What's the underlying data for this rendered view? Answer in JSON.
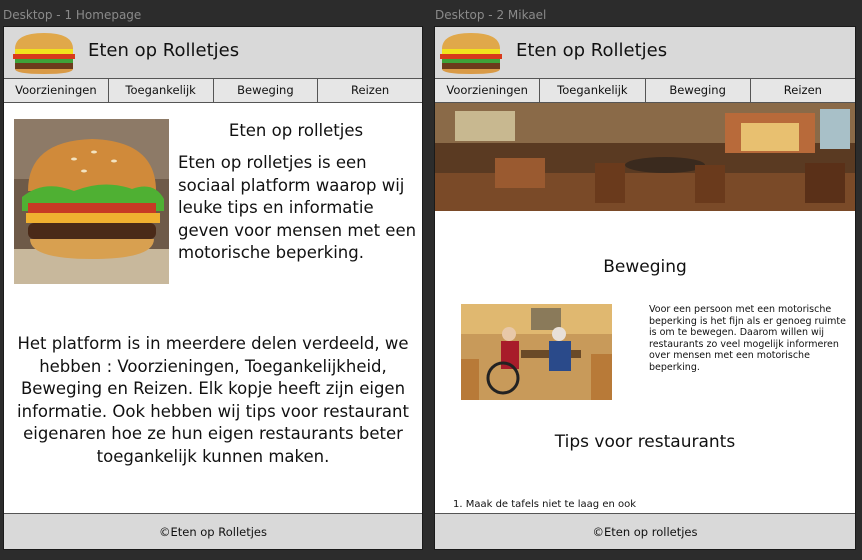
{
  "frames": [
    {
      "label": "Desktop - 1 Homepage",
      "brand": "Eten op Rolletjes",
      "nav": [
        "Voorzieningen",
        "Toegankelijk",
        "Beweging",
        "Reizen"
      ],
      "title": "Eten op rolletjes",
      "lead": "Eten op rolletjes is een sociaal platform waarop wij leuke tips en informatie geven voor mensen met een motorische beperking.",
      "body": "Het platform is in meerdere delen verdeeld, we hebben : Voorzieningen, Toegankelijkheid, Beweging en Reizen. Elk kopje heeft zijn eigen informatie. Ook hebben wij tips voor restaurant eigenaren hoe ze hun eigen restaurants beter toegankelijk kunnen maken.",
      "footer": "©Eten op Rolletjes"
    },
    {
      "label": "Desktop - 2 Mikael",
      "brand": "Eten op Rolletjes",
      "nav": [
        "Voorzieningen",
        "Toegankelijk",
        "Beweging",
        "Reizen"
      ],
      "section_title": "Beweging",
      "section_text": "Voor een persoon met een motorische beperking is het fijn als er genoeg ruimte is om te bewegen. Daarom willen wij restaurants zo veel mogelijk informeren over mensen met een motorische beperking.",
      "tips_title": "Tips voor restaurants",
      "tips": [
        "1. Maak de tafels niet te laag en ook"
      ],
      "footer": "©Eten op rolletjes"
    }
  ],
  "colors": {
    "canvas": "#2c2c2c",
    "header": "#d9d9d9",
    "nav": "#e6e6e6",
    "page": "#ffffff"
  },
  "icons": {
    "logo": "burger-icon"
  }
}
